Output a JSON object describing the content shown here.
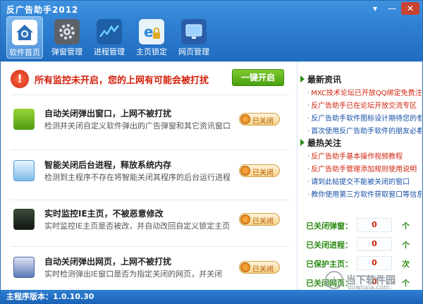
{
  "window": {
    "title": "反广告助手2012"
  },
  "toolbar": {
    "items": [
      {
        "label": "软件首页",
        "icon": "home-icon",
        "active": true
      },
      {
        "label": "弹窗管理",
        "icon": "gear-icon",
        "active": false
      },
      {
        "label": "进程管理",
        "icon": "chart-icon",
        "active": false
      },
      {
        "label": "主页锁定",
        "icon": "ie-lock-icon",
        "active": false
      },
      {
        "label": "网页管理",
        "icon": "monitor-icon",
        "active": false
      }
    ]
  },
  "alert": {
    "message": "所有监控未开启，您的上网有可能会被打扰",
    "action_label": "一键开启"
  },
  "features": [
    {
      "name": "自动关闭弹出窗口，上网不被打扰",
      "desc": "检测并关闭自定义软件弹出的广告弹窗和其它资讯窗口",
      "state": "已关闭",
      "icon": "popup-close-icon"
    },
    {
      "name": "智能关闭后台进程，释放系统内存",
      "desc": "检测到主程序不存在将智能关闭其程序的后台运行进程",
      "state": "已关闭",
      "icon": "process-icon"
    },
    {
      "name": "实时监控IE主页，不被恶意修改",
      "desc": "实时监控IE主页是否被改，并自动改回自定义锁定主页",
      "state": "已关闭",
      "icon": "ie-monitor-icon"
    },
    {
      "name": "自动关闭弹出网页，上网不被打扰",
      "desc": "实时检测弹出IE窗口是否为指定关闭的网页，并关闭",
      "state": "已关闭",
      "icon": "webpage-close-icon"
    }
  ],
  "news": {
    "title": "最新资讯",
    "items": [
      {
        "text": "MXC技术论坛已开放QQ绑定免费注册",
        "color": "red"
      },
      {
        "text": "反广告助手已在论坛开放交流专区",
        "color": "red"
      },
      {
        "text": "反广告助手软件图标设计期待您的参与",
        "color": "blue"
      },
      {
        "text": "首次使用反广告助手软件的朋友必看",
        "color": "blue"
      }
    ]
  },
  "hot": {
    "title": "最热关注",
    "items": [
      {
        "text": "反广告助手基本操作视频教程",
        "color": "red"
      },
      {
        "text": "反广告助手管理添加规则使用说明",
        "color": "red"
      },
      {
        "text": "请到此帖提交不能被关闭的窗口",
        "color": "blue"
      },
      {
        "text": "教你使用第三方软件获取窗口等信息",
        "color": "blue"
      }
    ]
  },
  "stats": [
    {
      "label": "已关闭弹窗：",
      "value": "0",
      "unit": "个"
    },
    {
      "label": "已关闭进程：",
      "value": "0",
      "unit": "个"
    },
    {
      "label": "已保护主页：",
      "value": "0",
      "unit": "次"
    },
    {
      "label": "已关闭网页：",
      "value": "0",
      "unit": "个"
    }
  ],
  "footer": {
    "version": "主程序版本：1.0.10.30"
  },
  "watermark": {
    "text": "当下软件园",
    "sub": "downxia.com"
  },
  "colors": {
    "titlebar": "#2f7fd2",
    "accent_green": "#2b8a13",
    "alert_red": "#d21f0a"
  }
}
